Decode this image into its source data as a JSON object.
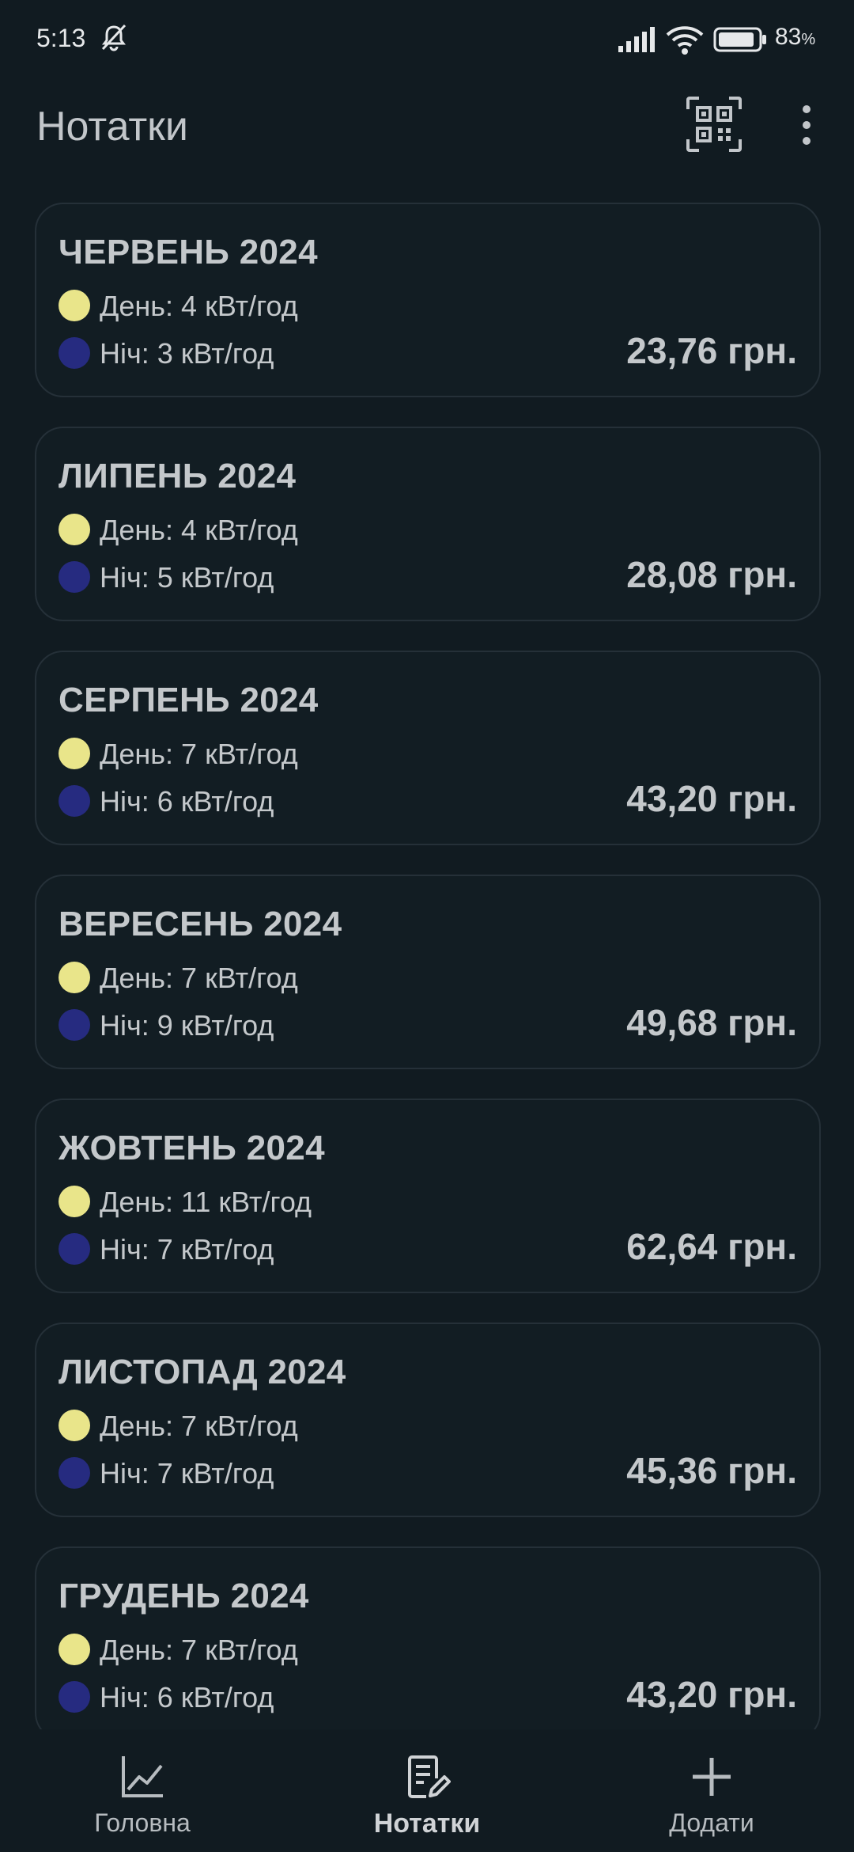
{
  "status_bar": {
    "time": "5:13",
    "battery_percent": "83",
    "battery_unit": "%"
  },
  "app_bar": {
    "title": "Нотатки",
    "qr_icon": "qr-code-scan-icon",
    "more_icon": "more-vertical-icon"
  },
  "legend_colors": {
    "day": "#e9e58a",
    "night": "#262b80"
  },
  "notes": [
    {
      "title": "ЧЕРВЕНЬ 2024",
      "day": "День: 4 кВт/год",
      "night": "Ніч: 3 кВт/год",
      "total": "23,76 грн."
    },
    {
      "title": "ЛИПЕНЬ 2024",
      "day": "День: 4 кВт/год",
      "night": "Ніч: 5 кВт/год",
      "total": "28,08 грн."
    },
    {
      "title": "СЕРПЕНЬ 2024",
      "day": "День: 7 кВт/год",
      "night": "Ніч: 6 кВт/год",
      "total": "43,20 грн."
    },
    {
      "title": "ВЕРЕСЕНЬ 2024",
      "day": "День: 7 кВт/год",
      "night": "Ніч: 9 кВт/год",
      "total": "49,68 грн."
    },
    {
      "title": "ЖОВТЕНЬ 2024",
      "day": "День: 11 кВт/год",
      "night": "Ніч: 7 кВт/год",
      "total": "62,64 грн."
    },
    {
      "title": "ЛИСТОПАД 2024",
      "day": "День: 7 кВт/год",
      "night": "Ніч: 7 кВт/год",
      "total": "45,36 грн."
    },
    {
      "title": "ГРУДЕНЬ 2024",
      "day": "День: 7 кВт/год",
      "night": "Ніч: 6 кВт/год",
      "total": "43,20 грн."
    }
  ],
  "bottom_nav": {
    "home": {
      "label": "Головна",
      "icon": "chart-line-icon"
    },
    "notes": {
      "label": "Нотатки",
      "icon": "note-edit-icon",
      "active": true
    },
    "add": {
      "label": "Додати",
      "icon": "plus-icon"
    }
  }
}
